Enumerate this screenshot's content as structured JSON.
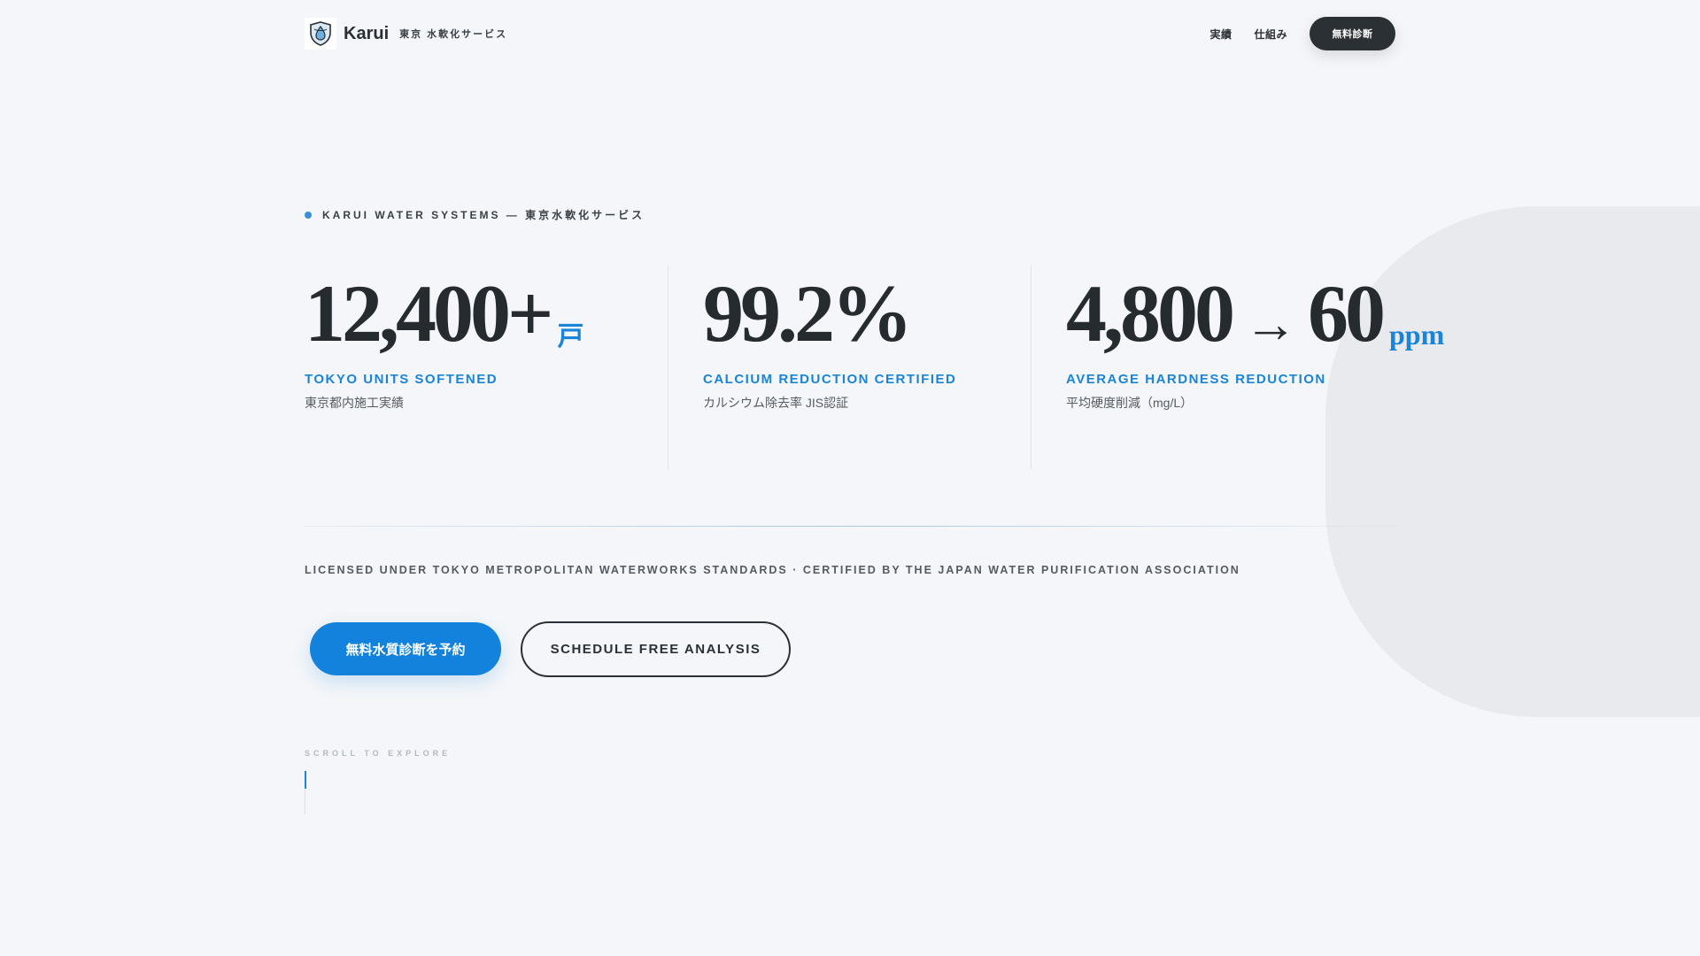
{
  "header": {
    "brand_name": "Karui",
    "brand_sub": "東京 水軟化サービス",
    "nav": [
      {
        "label": "実績"
      },
      {
        "label": "仕組み"
      }
    ],
    "cta_label": "無料診断"
  },
  "hero": {
    "eyebrow": "KARUI WATER SYSTEMS — 東京水軟化サービス",
    "stats": [
      {
        "value": "12,400+",
        "unit": "戸",
        "label": "TOKYO UNITS SOFTENED",
        "sub": "東京都内施工実績"
      },
      {
        "value": "99.2%",
        "label": "CALCIUM REDUCTION CERTIFIED",
        "sub": "カルシウム除去率 JIS認証"
      },
      {
        "value_from": "4,800",
        "arrow": "→",
        "value_to": "60",
        "unit": "ppm",
        "label": "AVERAGE HARDNESS REDUCTION",
        "sub": "平均硬度削減（mg/L）"
      }
    ],
    "licensed": "LICENSED UNDER TOKYO METROPOLITAN WATERWORKS STANDARDS · CERTIFIED BY THE JAPAN WATER PURIFICATION ASSOCIATION",
    "primary_cta": "無料水質診断を予約",
    "secondary_cta": "SCHEDULE FREE ANALYSIS",
    "scroll_hint": "SCROLL TO EXPLORE"
  },
  "colors": {
    "accent": "#1a84d8",
    "dark": "#2a3035",
    "background": "#f4f6f9"
  },
  "icons": {
    "logo": "shield-logo-icon"
  }
}
